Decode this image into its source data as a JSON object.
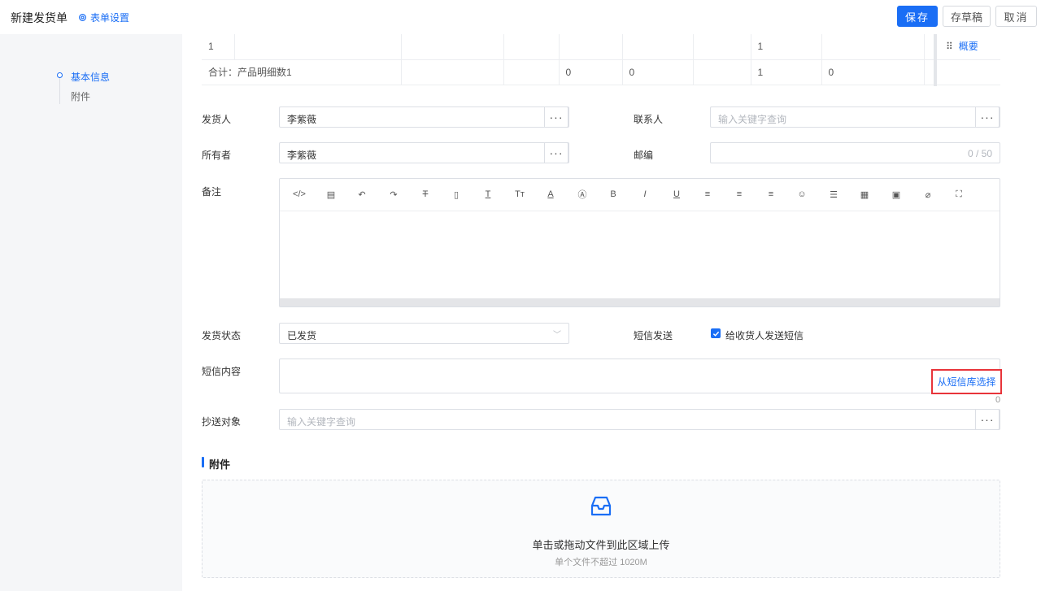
{
  "header": {
    "title": "新建发货单",
    "form_settings": "表单设置",
    "save": "保存",
    "draft": "存草稿",
    "cancel": "取消"
  },
  "nav": {
    "items": [
      {
        "label": "基本信息",
        "active": true
      },
      {
        "label": "附件",
        "active": false
      }
    ]
  },
  "table": {
    "rows": [
      [
        "1",
        "",
        "",
        "",
        "",
        "",
        "",
        "1",
        "",
        ""
      ],
      [
        "合计：产品明细数1",
        "",
        "",
        "0",
        "0",
        "",
        "1",
        "0",
        "",
        ""
      ]
    ],
    "overview_label": "概要"
  },
  "form": {
    "shipper": {
      "label": "发货人",
      "value": "李紫薇"
    },
    "contact": {
      "label": "联系人",
      "placeholder": "输入关键字查询"
    },
    "owner": {
      "label": "所有者",
      "value": "李紫薇"
    },
    "postcode": {
      "label": "邮编",
      "counter": "0 / 50"
    },
    "remark": {
      "label": "备注"
    },
    "ship_status": {
      "label": "发货状态",
      "value": "已发货"
    },
    "sms_send": {
      "label": "短信发送",
      "checkbox_label": "给收货人发送短信",
      "checked": true
    },
    "sms_content": {
      "label": "短信内容",
      "library_link": "从短信库选择",
      "count": "0"
    },
    "cc": {
      "label": "抄送对象",
      "placeholder": "输入关键字查询"
    }
  },
  "toolbar_icons": [
    "code-icon",
    "template-icon",
    "undo-icon",
    "redo-icon",
    "strikethrough-icon",
    "paste-text-icon",
    "font-family-icon",
    "font-size-icon",
    "font-color-icon",
    "background-color-icon",
    "bold-icon",
    "italic-icon",
    "underline-icon",
    "align-left-icon",
    "align-center-icon",
    "align-right-icon",
    "emoji-icon",
    "line-height-icon",
    "table-icon",
    "image-icon",
    "attachment-icon",
    "fullscreen-icon"
  ],
  "attachments": {
    "section_title": "附件",
    "upload_main": "单击或拖动文件到此区域上传",
    "upload_sub": "单个文件不超过 1020M"
  },
  "colors": {
    "accent": "#1a6ef5",
    "highlight_border": "#e8343a"
  }
}
